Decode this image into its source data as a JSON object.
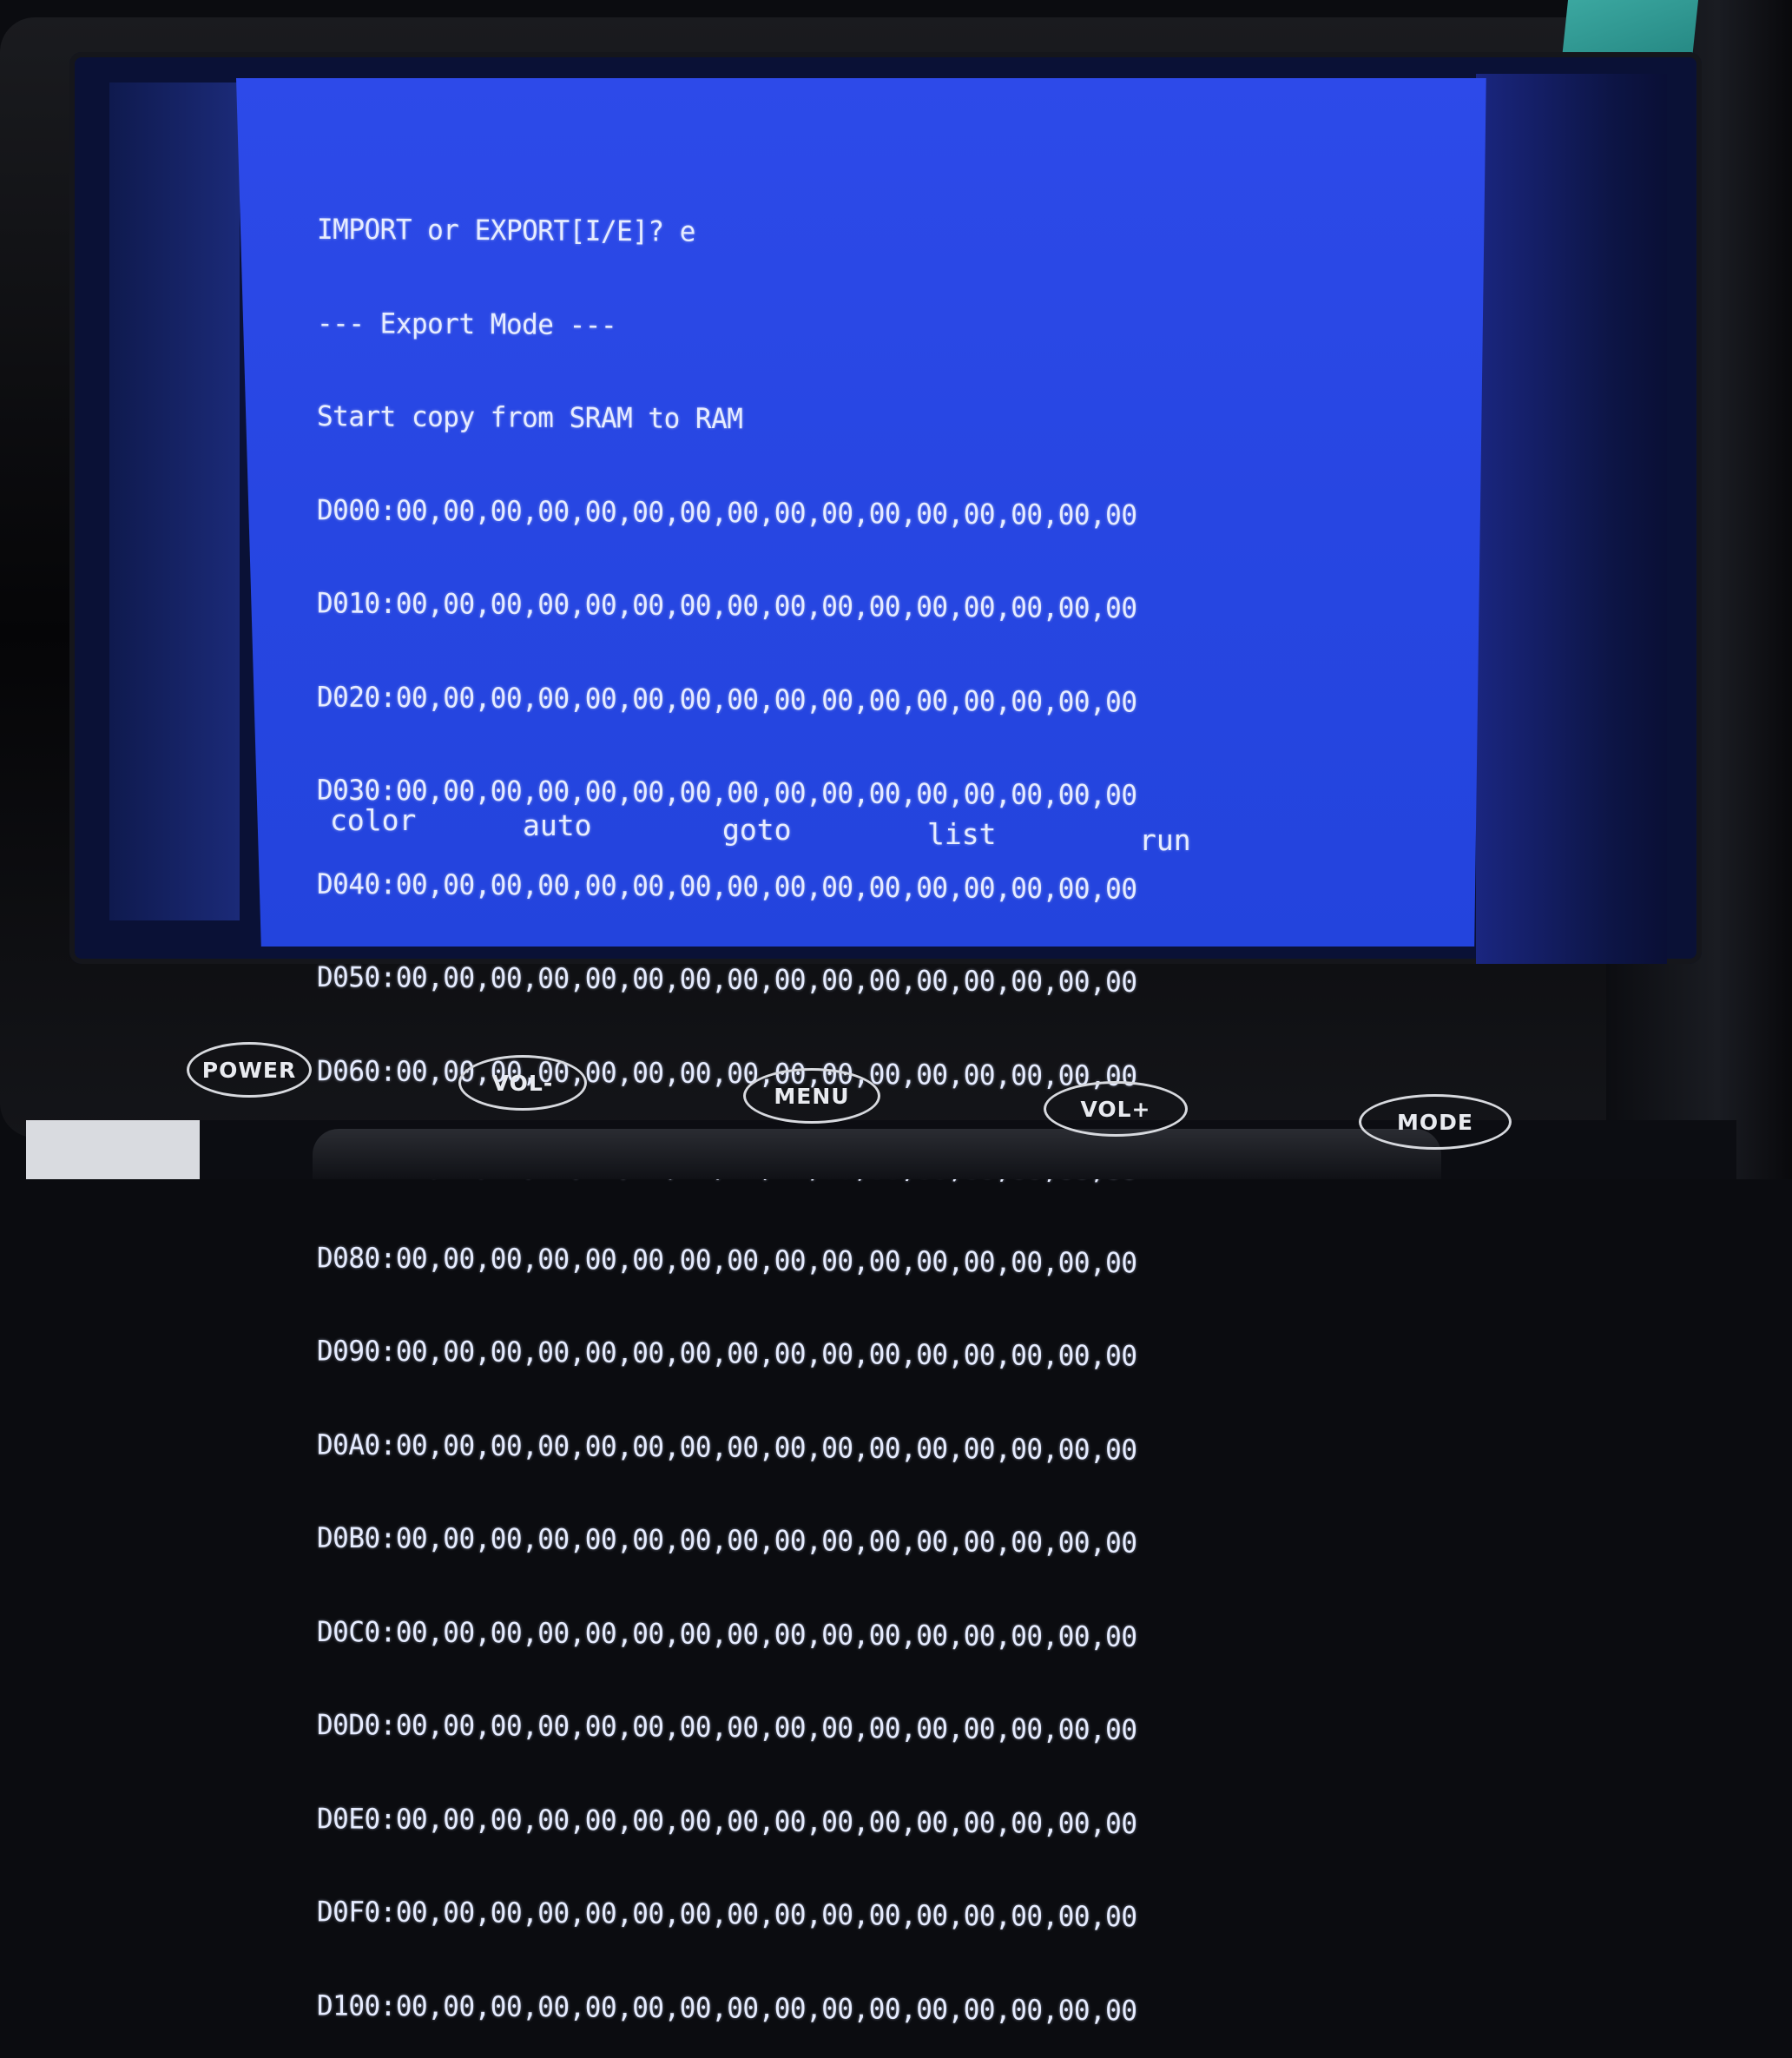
{
  "terminal": {
    "lines": [
      "IMPORT or EXPORT[I/E]? e",
      "--- Export Mode ---",
      "Start copy from SRAM to RAM",
      "D000:00,00,00,00,00,00,00,00,00,00,00,00,00,00,00,00",
      "D010:00,00,00,00,00,00,00,00,00,00,00,00,00,00,00,00",
      "D020:00,00,00,00,00,00,00,00,00,00,00,00,00,00,00,00",
      "D030:00,00,00,00,00,00,00,00,00,00,00,00,00,00,00,00",
      "D040:00,00,00,00,00,00,00,00,00,00,00,00,00,00,00,00",
      "D050:00,00,00,00,00,00,00,00,00,00,00,00,00,00,00,00",
      "D060:00,00,00,00,00,00,00,00,00,00,00,00,00,00,00,00",
      "D070:00,00,00,00,00,00,00,00,00,00,00,00,00,00,00,00",
      "D080:00,00,00,00,00,00,00,00,00,00,00,00,00,00,00,00",
      "D090:00,00,00,00,00,00,00,00,00,00,00,00,00,00,00,00",
      "D0A0:00,00,00,00,00,00,00,00,00,00,00,00,00,00,00,00",
      "D0B0:00,00,00,00,00,00,00,00,00,00,00,00,00,00,00,00",
      "D0C0:00,00,00,00,00,00,00,00,00,00,00,00,00,00,00,00",
      "D0D0:00,00,00,00,00,00,00,00,00,00,00,00,00,00,00,00",
      "D0E0:00,00,00,00,00,00,00,00,00,00,00,00,00,00,00,00",
      "D0F0:00,00,00,00,00,00,00,00,00,00,00,00,00,00,00,00",
      "D100:00,00,00,00,00,00,00,00,00,00,00,00,00,00,00,00"
    ],
    "function_keys": [
      "color",
      "auto",
      "goto",
      "list",
      "run"
    ]
  },
  "monitor_buttons": {
    "power": "POWER",
    "vol_down": "VOL-",
    "menu": "MENU",
    "vol_up": "VOL+",
    "mode": "MODE"
  },
  "colors": {
    "screen_background": "#2b47e6",
    "text": "#e6ecff",
    "bezel": "#0b0c10"
  }
}
